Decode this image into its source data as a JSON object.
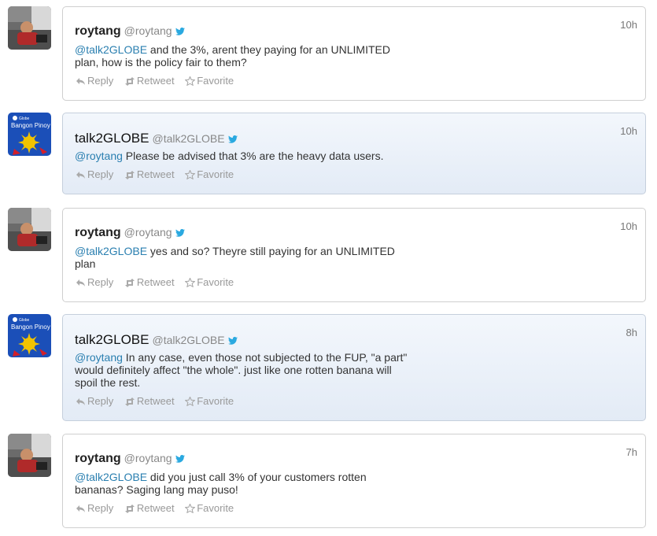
{
  "tweets": [
    {
      "fullname": "roytang",
      "username": "@roytang",
      "time": "10h",
      "mention": "@talk2GLOBE",
      "text": " and the 3%, arent they paying for an UNLIMITED plan, how is the policy fair to them?",
      "highlight": false,
      "avatar": "roytang-avatar"
    },
    {
      "fullname": "talk2GLOBE",
      "username": "@talk2GLOBE",
      "time": "10h",
      "mention": "@roytang",
      "text": " Please be advised that 3% are the heavy data users.",
      "highlight": true,
      "avatar": "globe-avatar"
    },
    {
      "fullname": "roytang",
      "username": "@roytang",
      "time": "10h",
      "mention": "@talk2GLOBE",
      "text": " yes and so? Theyre still paying for an UNLIMITED plan",
      "highlight": false,
      "avatar": "roytang-avatar"
    },
    {
      "fullname": "talk2GLOBE",
      "username": "@talk2GLOBE",
      "time": "8h",
      "mention": "@roytang",
      "text": " In any case, even those not subjected to the FUP, \"a part\" would definitely affect \"the whole\". just like one rotten banana will spoil the rest.",
      "highlight": true,
      "avatar": "globe-avatar"
    },
    {
      "fullname": "roytang",
      "username": "@roytang",
      "time": "7h",
      "mention": "@talk2GLOBE",
      "text": " did you just call 3% of your customers rotten bananas? Saging lang may puso!",
      "highlight": false,
      "avatar": "roytang-avatar"
    }
  ],
  "actions": {
    "reply": "Reply",
    "retweet": "Retweet",
    "favorite": "Favorite"
  },
  "avatar_text": {
    "globe_brand": "Globe",
    "globe_tagline": "Bangon Pinoy"
  },
  "colors": {
    "mention": "#2a7fb0",
    "twitter_bird": "#2aa9e0",
    "highlight_top": "#f3f7fc",
    "highlight_bottom": "#e3ebf6"
  }
}
